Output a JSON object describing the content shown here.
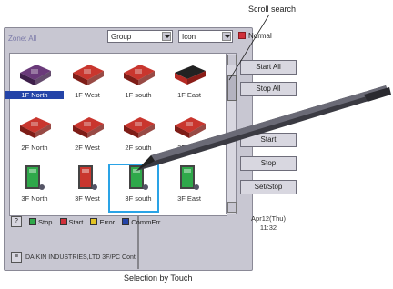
{
  "callouts": {
    "top": "Scroll search",
    "bottom": "Selection by Touch"
  },
  "header": {
    "zone_title": "Zone: All",
    "group_select": "Group",
    "view_select": "Icon",
    "mode_label": "Normal",
    "mode_color": "#d0303a"
  },
  "units": [
    {
      "label": "1F North",
      "type": "cassette-purple",
      "selected_label": true
    },
    {
      "label": "1F West",
      "type": "cassette-red"
    },
    {
      "label": "1F south",
      "type": "cassette-red"
    },
    {
      "label": "1F East",
      "type": "wall-dark"
    },
    {
      "label": "2F North",
      "type": "cassette-red"
    },
    {
      "label": "2F West",
      "type": "cassette-red"
    },
    {
      "label": "2F south",
      "type": "cassette-red"
    },
    {
      "label": "2F East",
      "type": "cassette-red"
    },
    {
      "label": "3F North",
      "type": "panel-green"
    },
    {
      "label": "3F West",
      "type": "panel-red"
    },
    {
      "label": "3F south",
      "type": "panel-green",
      "touched": true
    },
    {
      "label": "3F East",
      "type": "panel-green"
    }
  ],
  "buttons": {
    "start_all": "Start All",
    "stop_all": "Stop All",
    "start": "Start",
    "stop": "Stop",
    "set_stop": "Set/Stop"
  },
  "legend": {
    "help": "?",
    "items": [
      {
        "label": "Stop",
        "color": "#2fa84a"
      },
      {
        "label": "Start",
        "color": "#d0303a"
      },
      {
        "label": "Error",
        "color": "#e3c325"
      },
      {
        "label": "CommErr",
        "color": "#2444a8"
      }
    ]
  },
  "clock": {
    "date": "Apr12(Thu)",
    "time": "11:32"
  },
  "status_bar": {
    "menu_button": "≡",
    "text": "DAIKIN INDUSTRIES,LTD 3F/PC Cont"
  }
}
